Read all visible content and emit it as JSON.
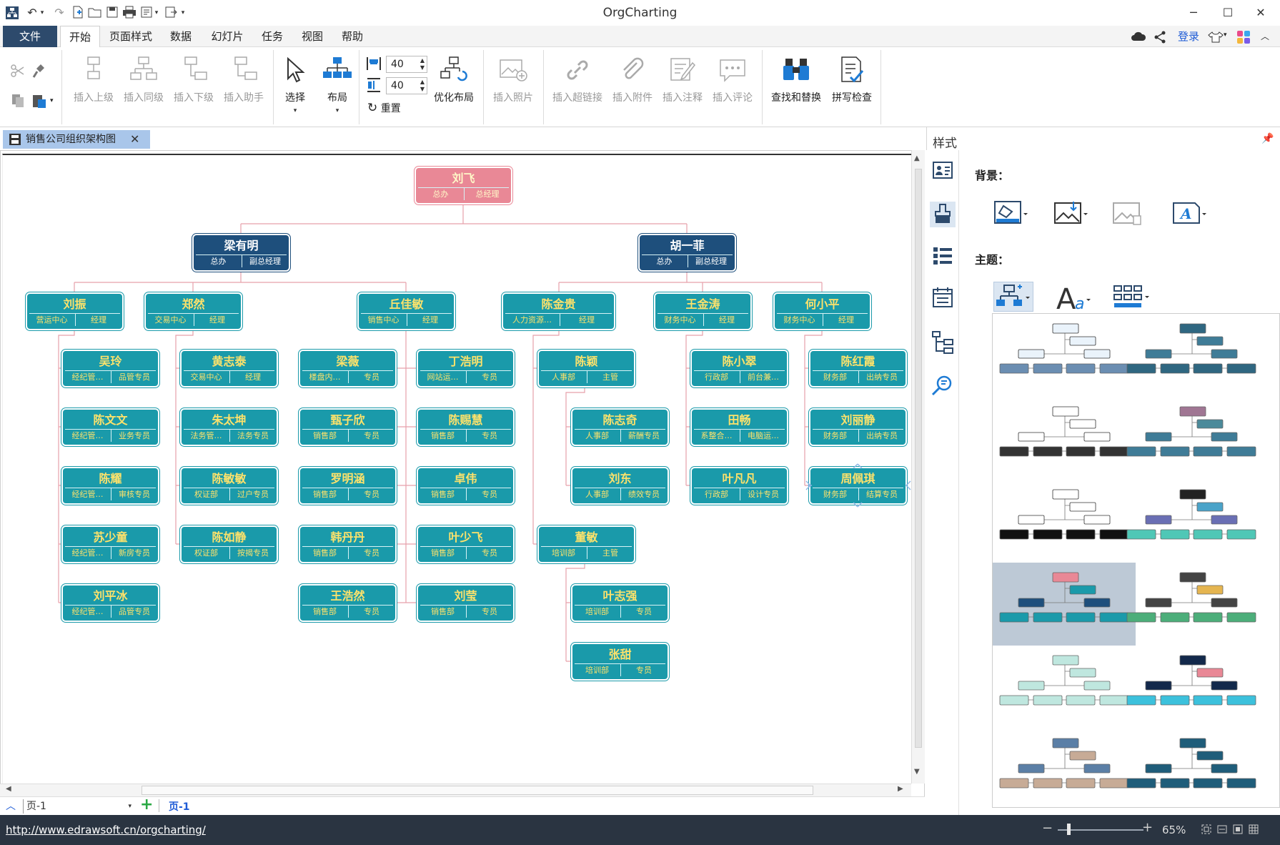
{
  "window": {
    "title": "OrgCharting"
  },
  "menu": [
    "文件",
    "开始",
    "页面样式",
    "数据",
    "幻灯片",
    "任务",
    "视图",
    "帮助"
  ],
  "account": {
    "login": "登录"
  },
  "ribbon": {
    "insert_superior": "插入上级",
    "insert_sibling": "插入同级",
    "insert_subordinate": "插入下级",
    "insert_assistant": "插入助手",
    "select": "选择",
    "layout": "布局",
    "spacing_h": "40",
    "spacing_v": "40",
    "reset": "重置",
    "optimize_layout": "优化布局",
    "insert_photo": "插入照片",
    "insert_hyperlink": "插入超链接",
    "insert_attachment": "插入附件",
    "insert_note": "插入注释",
    "insert_comment": "插入评论",
    "find_replace": "查找和替换",
    "spell_check": "拼写检查"
  },
  "document_tab": "销售公司组织架构图",
  "style_panel": {
    "title": "样式",
    "background_label": "背景：",
    "theme_label": "主题："
  },
  "pages": {
    "current": "页-1",
    "tab": "页-1"
  },
  "status": {
    "url": "http://www.edrawsoft.cn/orgcharting/",
    "zoom": "65%"
  },
  "theme_colors": {
    "teal": "#1a9aaa",
    "navy": "#1e4f7c",
    "pink": "#e98896",
    "text_yellow": "#fde26b",
    "line_pink": "#e7a0aa"
  },
  "org": {
    "root": {
      "name": "刘飞",
      "dept": "总办",
      "role": "总经理"
    },
    "vps": [
      {
        "name": "梁有明",
        "dept": "总办",
        "role": "副总经理"
      },
      {
        "name": "胡一菲",
        "dept": "总办",
        "role": "副总经理"
      }
    ],
    "managers": [
      {
        "name": "刘振",
        "dept": "营运中心",
        "role": "经理"
      },
      {
        "name": "郑然",
        "dept": "交易中心",
        "role": "经理"
      },
      {
        "name": "丘佳敏",
        "dept": "销售中心",
        "role": "经理"
      },
      {
        "name": "陈金贵",
        "dept": "人力资源…",
        "role": "经理"
      },
      {
        "name": "王金涛",
        "dept": "财务中心",
        "role": "经理"
      },
      {
        "name": "何小平",
        "dept": "财务中心",
        "role": "经理"
      }
    ],
    "staff": [
      {
        "name": "吴玲",
        "dept": "经纪管…",
        "role": "品管专员"
      },
      {
        "name": "陈文文",
        "dept": "经纪管…",
        "role": "业务专员"
      },
      {
        "name": "陈耀",
        "dept": "经纪管…",
        "role": "审核专员"
      },
      {
        "name": "苏少童",
        "dept": "经纪管…",
        "role": "新房专员"
      },
      {
        "name": "刘平冰",
        "dept": "经纪管…",
        "role": "品管专员"
      },
      {
        "name": "黄志泰",
        "dept": "交易中心",
        "role": "经理"
      },
      {
        "name": "朱太坤",
        "dept": "法务管…",
        "role": "法务专员"
      },
      {
        "name": "陈敏敏",
        "dept": "权证部",
        "role": "过户专员"
      },
      {
        "name": "陈如静",
        "dept": "权证部",
        "role": "按揭专员"
      },
      {
        "name": "梁薇",
        "dept": "楼盘内…",
        "role": "专员"
      },
      {
        "name": "甄子欣",
        "dept": "销售部",
        "role": "专员"
      },
      {
        "name": "罗明涵",
        "dept": "销售部",
        "role": "专员"
      },
      {
        "name": "韩丹丹",
        "dept": "销售部",
        "role": "专员"
      },
      {
        "name": "王浩然",
        "dept": "销售部",
        "role": "专员"
      },
      {
        "name": "丁浩明",
        "dept": "网站运…",
        "role": "专员"
      },
      {
        "name": "陈赐慧",
        "dept": "销售部",
        "role": "专员"
      },
      {
        "name": "卓伟",
        "dept": "销售部",
        "role": "专员"
      },
      {
        "name": "叶少飞",
        "dept": "销售部",
        "role": "专员"
      },
      {
        "name": "刘莹",
        "dept": "销售部",
        "role": "专员"
      },
      {
        "name": "陈颖",
        "dept": "人事部",
        "role": "主管"
      },
      {
        "name": "陈志奇",
        "dept": "人事部",
        "role": "薪酬专员"
      },
      {
        "name": "刘东",
        "dept": "人事部",
        "role": "绩效专员"
      },
      {
        "name": "董敏",
        "dept": "培训部",
        "role": "主管"
      },
      {
        "name": "叶志强",
        "dept": "培训部",
        "role": "专员"
      },
      {
        "name": "张甜",
        "dept": "培训部",
        "role": "专员"
      },
      {
        "name": "陈小翠",
        "dept": "行政部",
        "role": "前台兼…"
      },
      {
        "name": "田畅",
        "dept": "系整合…",
        "role": "电脑运…"
      },
      {
        "name": "叶凡凡",
        "dept": "行政部",
        "role": "设计专员"
      },
      {
        "name": "陈红霞",
        "dept": "财务部",
        "role": "出纳专员"
      },
      {
        "name": "刘丽静",
        "dept": "财务部",
        "role": "出纳专员"
      },
      {
        "name": "周佩琪",
        "dept": "财务部",
        "role": "结算专员"
      }
    ]
  }
}
